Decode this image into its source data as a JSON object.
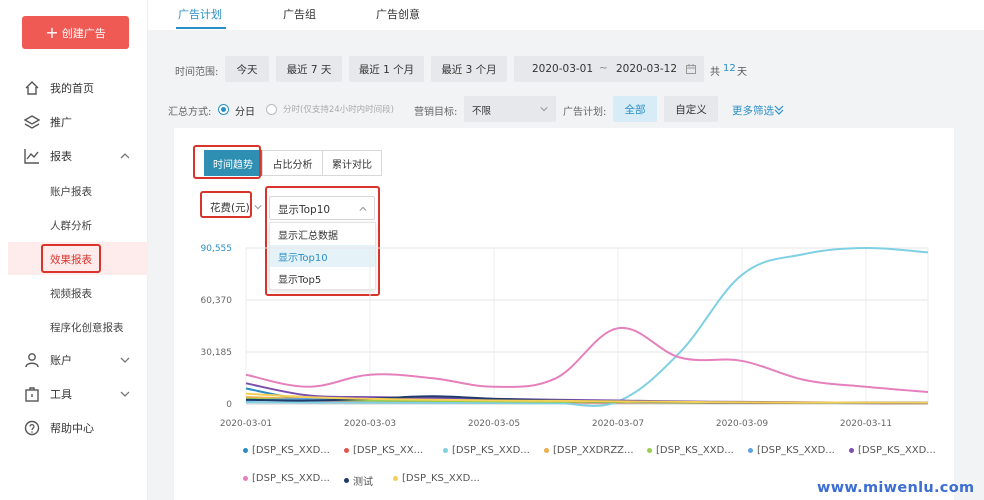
{
  "sidebar": {
    "create_button": "创建广告",
    "items": [
      {
        "label": "我的首页"
      },
      {
        "label": "推广"
      },
      {
        "label": "报表"
      },
      {
        "label": "账户"
      },
      {
        "label": "工具"
      },
      {
        "label": "帮助中心"
      }
    ],
    "report_sub": [
      "账户报表",
      "人群分析",
      "效果报表",
      "视频报表",
      "程序化创意报表"
    ]
  },
  "tabs": [
    "广告计划",
    "广告组",
    "广告创意"
  ],
  "filters": {
    "time_range_label": "时间范围:",
    "time_buttons": [
      "今天",
      "最近 7 天",
      "最近 1 个月",
      "最近 3 个月"
    ],
    "date_start": "2020-03-01",
    "date_sep": "~",
    "date_end": "2020-03-12",
    "total_prefix": "共",
    "total_days": "12",
    "total_suffix": "天",
    "summary_label": "汇总方式:",
    "summary_day": "分日",
    "summary_hour": "分时(仅支持24小时内时间段)",
    "marketing_label": "营销目标:",
    "marketing_value": "不限",
    "plan_label": "广告计划:",
    "plan_all": "全部",
    "plan_custom": "自定义",
    "more_filters": "更多筛选"
  },
  "chart_controls": {
    "segments": [
      "时间趋势",
      "占比分析",
      "累计对比"
    ],
    "metric": "花费(元)",
    "display_value": "显示Top10",
    "display_options": [
      "显示汇总数据",
      "显示Top10",
      "显示Top5"
    ]
  },
  "chart_data": {
    "type": "line",
    "title": "",
    "xlabel": "",
    "ylabel": "",
    "x": [
      "2020-03-01",
      "2020-03-02",
      "2020-03-03",
      "2020-03-04",
      "2020-03-05",
      "2020-03-06",
      "2020-03-07",
      "2020-03-08",
      "2020-03-09",
      "2020-03-10",
      "2020-03-11",
      "2020-03-12"
    ],
    "x_tick_labels": [
      "2020-03-01",
      "2020-03-03",
      "2020-03-05",
      "2020-03-07",
      "2020-03-09",
      "2020-03-11"
    ],
    "y_tick_labels": [
      "0",
      "30,185",
      "60,370",
      "90,555"
    ],
    "ylim": [
      0,
      90555
    ],
    "grid": true,
    "series": [
      {
        "name": "[DSP_KS_XXD...",
        "color": "#2c8bc3",
        "values": [
          9000,
          2500,
          3000,
          3500,
          2000,
          1500,
          1000,
          800,
          700,
          600,
          500,
          400
        ]
      },
      {
        "name": "[DSP_KS_XX...",
        "color": "#e0544a",
        "values": [
          3000,
          2000,
          1800,
          1500,
          1200,
          1000,
          900,
          800,
          700,
          600,
          500,
          400
        ]
      },
      {
        "name": "[DSP_KS_XXD...",
        "color": "#7fd0e3",
        "values": [
          1000,
          900,
          800,
          700,
          600,
          500,
          1500,
          30000,
          75000,
          87000,
          90555,
          88000
        ]
      },
      {
        "name": "[DSP_XXDRZZ...",
        "color": "#ecae4f",
        "values": [
          4000,
          3000,
          2500,
          2000,
          1800,
          1500,
          1200,
          1000,
          900,
          800,
          700,
          600
        ]
      },
      {
        "name": "[DSP_KS_XXD...",
        "color": "#9bcf4b",
        "values": [
          3000,
          2500,
          2000,
          1800,
          1500,
          1300,
          1100,
          900,
          800,
          700,
          600,
          500
        ]
      },
      {
        "name": "[DSP_KS_XXD...",
        "color": "#5ea3df",
        "values": [
          2000,
          3000,
          3500,
          3000,
          2500,
          2000,
          1500,
          1200,
          1000,
          800,
          700,
          600
        ]
      },
      {
        "name": "[DSP_KS_XXD...",
        "color": "#7a4fb0",
        "values": [
          12000,
          5000,
          4000,
          3500,
          3000,
          2500,
          2000,
          1500,
          1200,
          1000,
          800,
          600
        ]
      },
      {
        "name": "[DSP_KS_XXD...",
        "color": "#e680bd",
        "values": [
          17000,
          10000,
          17000,
          15000,
          10000,
          15000,
          44000,
          27000,
          25000,
          14000,
          10000,
          7000
        ]
      },
      {
        "name": "测试",
        "color": "#1f3a6b",
        "values": [
          2500,
          2000,
          3000,
          4500,
          3000,
          2000,
          1500,
          1200,
          1000,
          900,
          800,
          700
        ]
      },
      {
        "name": "[DSP_KS_XXD...",
        "color": "#f4cf57",
        "values": [
          6000,
          4000,
          3000,
          2500,
          2000,
          1800,
          1500,
          1200,
          1000,
          900,
          800,
          700
        ]
      }
    ]
  },
  "watermark": "www.miwenlu.com"
}
